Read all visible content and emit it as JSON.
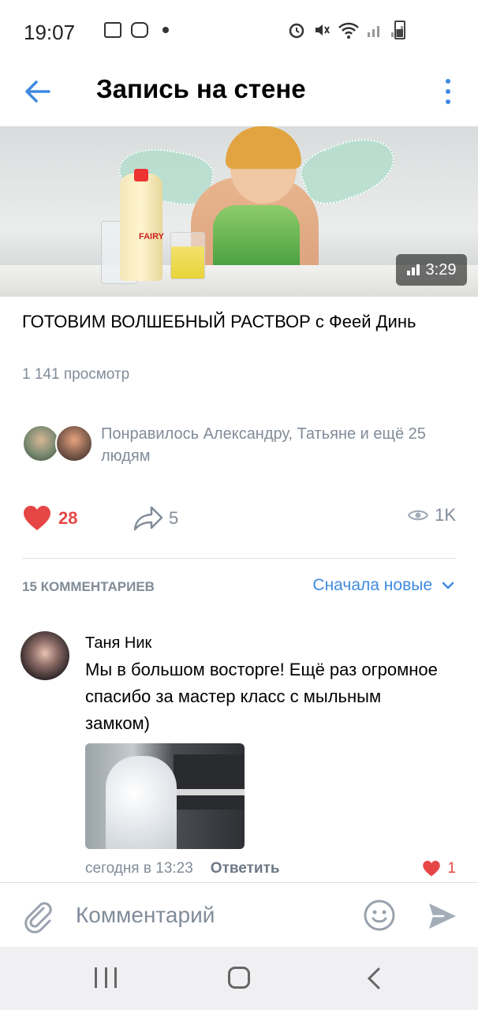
{
  "status_bar": {
    "time": "19:07"
  },
  "header": {
    "title": "Запись на стене"
  },
  "video": {
    "duration": "3:29",
    "bottle_label": "FAIRY",
    "title": "ГОТОВИМ ВОЛШЕБНЫЙ РАСТВОР с Феей Динь",
    "views": "1 141 просмотр"
  },
  "likers": {
    "text": "Понравилось Александру, Татьяне и ещё 25 людям"
  },
  "actions": {
    "likes": "28",
    "shares": "5",
    "views": "1K"
  },
  "comments": {
    "count_label": "15 КОММЕНТАРИЕВ",
    "sort_label": "Сначала новые",
    "items": [
      {
        "author": "Таня Ник",
        "text": "Мы в большом восторге! Ещё раз огромное спасибо за мастер класс с мыльным замком)",
        "time": "сегодня в 13:23",
        "reply_label": "Ответить",
        "likes": "1"
      }
    ]
  },
  "composer": {
    "placeholder": "Комментарий"
  },
  "colors": {
    "accent": "#3f8ae0",
    "like_red": "#e64646",
    "secondary_text": "#818c99"
  }
}
